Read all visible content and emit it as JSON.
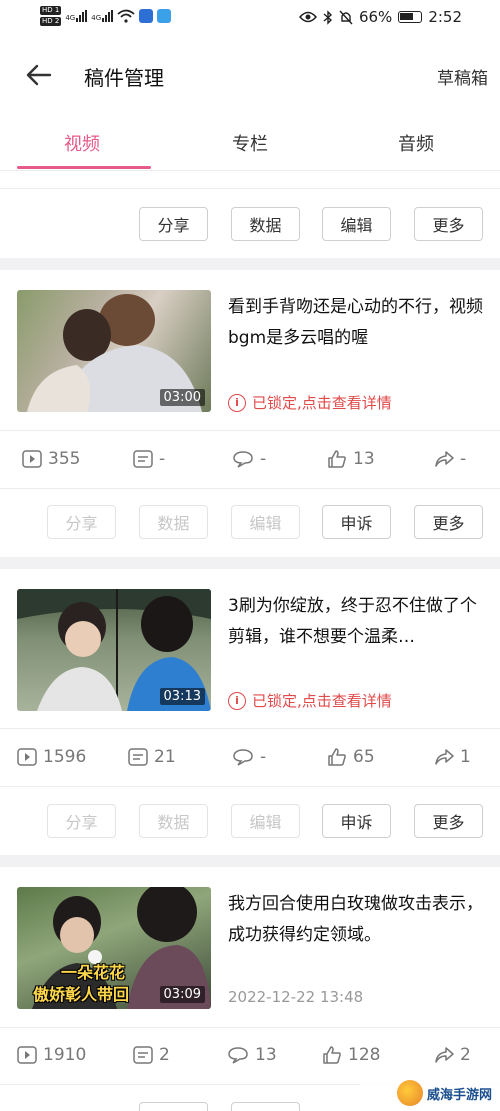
{
  "status_bar": {
    "hd1": "HD 1",
    "hd2": "HD 2",
    "net1": "4G",
    "net2": "4G",
    "battery_pct": "66%",
    "time": "2:52"
  },
  "header": {
    "title": "稿件管理",
    "drafts": "草稿箱"
  },
  "tabs": [
    {
      "label": "视频",
      "active": true
    },
    {
      "label": "专栏",
      "active": false
    },
    {
      "label": "音频",
      "active": false
    }
  ],
  "top_actions": [
    "分享",
    "数据",
    "编辑",
    "更多"
  ],
  "videos": [
    {
      "title": "看到手背吻还是心动的不行，视频bgm是多云唱的喔",
      "duration": "03:00",
      "status": "已锁定,点击查看详情",
      "plays": "355",
      "danmaku": "-",
      "comments": "-",
      "likes": "13",
      "shares": "-",
      "actions": [
        "分享",
        "数据",
        "编辑",
        "申诉",
        "更多"
      ]
    },
    {
      "title": "3刷为你绽放，终于忍不住做了个剪辑，谁不想要个温柔…",
      "duration": "03:13",
      "status": "已锁定,点击查看详情",
      "plays": "1596",
      "danmaku": "21",
      "comments": "-",
      "likes": "65",
      "shares": "1",
      "actions": [
        "分享",
        "数据",
        "编辑",
        "申诉",
        "更多"
      ]
    },
    {
      "title": "我方回合使用白玫瑰做攻击表示，成功获得约定领域。",
      "duration": "03:09",
      "overlay_line1": "一朵花花",
      "overlay_line2": "傲娇彰人带回",
      "date": "2022-12-22 13:48",
      "plays": "1910",
      "danmaku": "2",
      "comments": "13",
      "likes": "128",
      "shares": "2"
    }
  ],
  "watermark": "威海手游网",
  "colors": {
    "accent": "#e65a8a",
    "locked": "#e04a4a"
  }
}
